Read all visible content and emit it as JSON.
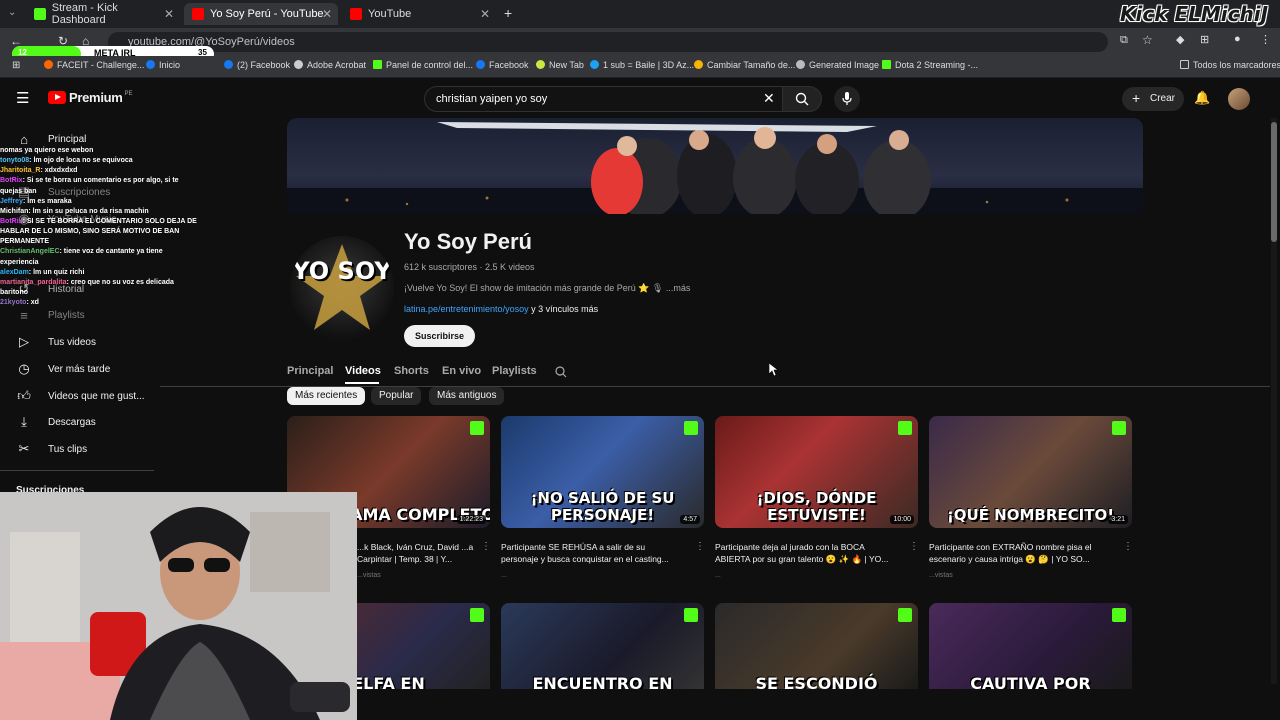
{
  "browser": {
    "tabs": [
      {
        "label": "Stream - Kick Dashboard",
        "color": "#53fc18"
      },
      {
        "label": "Yo Soy Perú - YouTube",
        "color": "#ff0000"
      },
      {
        "label": "YouTube",
        "color": "#ff0000"
      }
    ],
    "url": "youtube.com/@YoSoyPerú/videos",
    "bookmarks": [
      "FACEIT - Challenge...",
      "Inicio",
      "(2) Facebook",
      "Adobe Acrobat",
      "Panel de control del...",
      "Facebook",
      "New Tab",
      "1 sub = Baile | 3D Az...",
      "Cambiar Tamaño de...",
      "Generated Image",
      "Dota 2 Streaming -...",
      "Todos los marcadores"
    ]
  },
  "overlay": {
    "goal_label": "META IRL",
    "goal_current": "12",
    "goal_target": "35",
    "goal_progress": 0.34,
    "brand": "Kick ELMichiJ"
  },
  "youtube": {
    "logo": "Premium",
    "logo_region": "PE",
    "search_value": "christian yaipen yo soy",
    "create_label": "Crear"
  },
  "sidebar": {
    "items": [
      {
        "label": "Principal",
        "icon": "home-icon"
      },
      {
        "label": "Suscripciones",
        "icon": "subscriptions-icon"
      },
      {
        "label": "YouTube Music",
        "icon": "music-icon"
      },
      {
        "label": "Historial",
        "icon": "history-icon"
      },
      {
        "label": "Playlists",
        "icon": "playlist-icon"
      },
      {
        "label": "Tus videos",
        "icon": "video-icon"
      },
      {
        "label": "Ver más tarde",
        "icon": "clock-icon"
      },
      {
        "label": "Videos que me gust...",
        "icon": "thumb-up-icon"
      },
      {
        "label": "Descargas",
        "icon": "download-icon"
      },
      {
        "label": "Tus clips",
        "icon": "scissors-icon"
      }
    ],
    "section": "Suscripciones"
  },
  "chat": [
    {
      "user": "",
      "msg": "nomas ya quiero ese webon"
    },
    {
      "user": "tonyto08",
      "msg": ": lm ojo de loca no se equivoca"
    },
    {
      "user": "Jharitoita_R",
      "msg": ": xdxdxdxd"
    },
    {
      "user": "BotRix",
      "msg": ": Si se te borra un comentario es por algo, si te quejas ban"
    },
    {
      "user": "Jeffrey",
      "msg": ": lm es maraka"
    },
    {
      "user": "Michifan",
      "msg": ": lm sin su peluca no da risa machin"
    },
    {
      "user": "BotRix",
      "msg": ": SI SE TE BORRA EL COMENTARIO SOLO DEJA DE HABLAR DE LO MISMO, SINO SERÁ MOTIVO DE BAN PERMANENTE"
    },
    {
      "user": "ChristianAngelEC",
      "msg": ": tiene voz de cantante ya tiene experiencia"
    },
    {
      "user": "alexDam",
      "msg": ": lm un quiz richi"
    },
    {
      "user": "martianita_pardalita",
      "msg": ": creo que no su voz es delicada baritono"
    },
    {
      "user": "21kyoto",
      "msg": ": xd"
    }
  ],
  "channel": {
    "name": "Yo Soy Perú",
    "stats": "612 k suscriptores · 2.5 K videos",
    "description": "¡Vuelve Yo Soy! El show de imitación más grande de Perú ⭐ 🎙 ...más",
    "link": "latina.pe/entretenimiento/yosoy",
    "link_extra": "y 3 vínculos más",
    "subscribe_label": "Suscribirse",
    "avatar_text": "YO SOY",
    "nav_tabs": [
      "Principal",
      "Videos",
      "Shorts",
      "En vivo",
      "Playlists"
    ],
    "chips": [
      "Más recientes",
      "Popular",
      "Más antiguos"
    ]
  },
  "videos": [
    {
      "caption": "PROGRAMA COMPLETO",
      "duration": "1:22:23",
      "title": "...k Black, Iván Cruz, David ...a Carpintar | Temp. 38 | Y...",
      "meta": "...vistas"
    },
    {
      "caption": "¡NO SALIÓ DE SU PERSONAJE!",
      "duration": "4:57",
      "title": "Participante SE REHÚSA a salir de su personaje y busca conquistar en el casting...",
      "meta": "..."
    },
    {
      "caption": "¡DIOS, DÓNDE ESTUVISTE!",
      "duration": "10:00",
      "title": "Participante deja al jurado con la BOCA ABIERTA por su gran talento 😮 ✨ 🔥 | YO...",
      "meta": "..."
    },
    {
      "caption": "¡QUÉ NOMBRECITO!",
      "duration": "3:21",
      "title": "Participante con EXTRAÑO nombre pisa el escenario y causa intriga 😮 🤔 | YO SO...",
      "meta": "...vistas"
    },
    {
      "caption": "ELFA EN",
      "duration": "",
      "title": "",
      "meta": ""
    },
    {
      "caption": "ENCUENTRO EN",
      "duration": "",
      "title": "",
      "meta": ""
    },
    {
      "caption": "SE ESCONDIÓ",
      "duration": "",
      "title": "",
      "meta": ""
    },
    {
      "caption": "CAUTIVA POR",
      "duration": "",
      "title": "",
      "meta": ""
    }
  ]
}
